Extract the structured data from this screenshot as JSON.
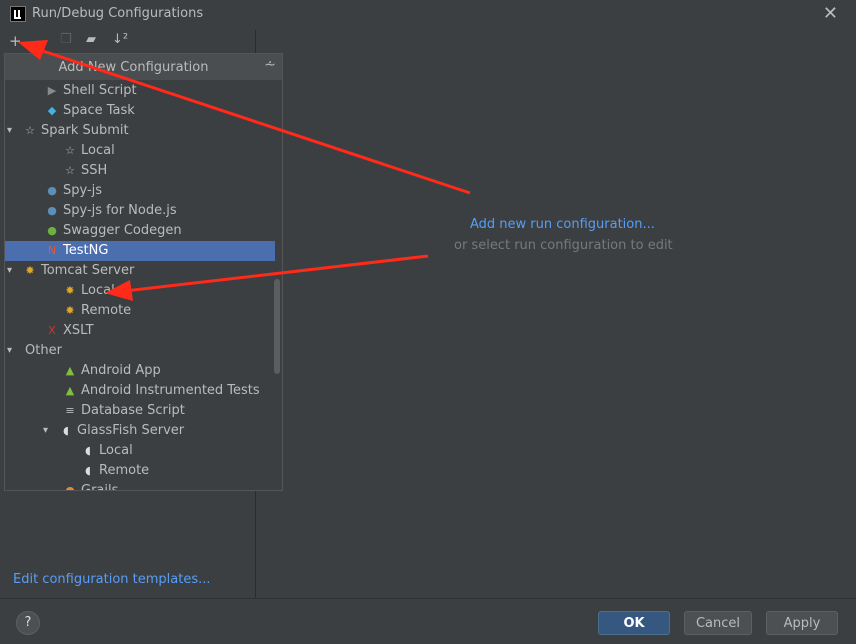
{
  "window": {
    "title": "Run/Debug Configurations"
  },
  "popup": {
    "title": "Add New Configuration"
  },
  "tree": [
    {
      "label": "Shell Script",
      "icon": "shell-script-icon",
      "indent": 1,
      "selected": false
    },
    {
      "label": "Space Task",
      "icon": "space-task-icon",
      "indent": 1,
      "selected": false
    },
    {
      "label": "Spark Submit",
      "icon": "spark-icon",
      "indent": 0,
      "expanded": true,
      "selected": false
    },
    {
      "label": "Local",
      "icon": "spark-icon",
      "indent": 2,
      "selected": false
    },
    {
      "label": "SSH",
      "icon": "spark-icon",
      "indent": 2,
      "selected": false
    },
    {
      "label": "Spy-js",
      "icon": "spy-js-icon",
      "indent": 1,
      "selected": false
    },
    {
      "label": "Spy-js for Node.js",
      "icon": "spy-js-icon",
      "indent": 1,
      "selected": false
    },
    {
      "label": "Swagger Codegen",
      "icon": "swagger-icon",
      "indent": 1,
      "selected": false
    },
    {
      "label": "TestNG",
      "icon": "testng-icon",
      "indent": 1,
      "selected": true
    },
    {
      "label": "Tomcat Server",
      "icon": "tomcat-icon",
      "indent": 0,
      "expanded": true,
      "selected": false
    },
    {
      "label": "Local",
      "icon": "tomcat-icon",
      "indent": 2,
      "selected": false
    },
    {
      "label": "Remote",
      "icon": "tomcat-icon",
      "indent": 2,
      "selected": false
    },
    {
      "label": "XSLT",
      "icon": "xslt-icon",
      "indent": 1,
      "selected": false
    },
    {
      "label": "Other",
      "icon": "",
      "indent": 0,
      "expanded": true,
      "selected": false
    },
    {
      "label": "Android App",
      "icon": "android-icon",
      "indent": 2,
      "selected": false
    },
    {
      "label": "Android Instrumented Tests",
      "icon": "android-icon",
      "indent": 2,
      "selected": false
    },
    {
      "label": "Database Script",
      "icon": "database-icon",
      "indent": 2,
      "selected": false
    },
    {
      "label": "GlassFish Server",
      "icon": "glassfish-icon",
      "indent": 2,
      "expanded": true,
      "selected": false
    },
    {
      "label": "Local",
      "icon": "glassfish-icon",
      "indent": 3,
      "selected": false
    },
    {
      "label": "Remote",
      "icon": "glassfish-icon",
      "indent": 3,
      "selected": false
    },
    {
      "label": "Grails",
      "icon": "grails-icon",
      "indent": 2,
      "selected": false
    }
  ],
  "left": {
    "edit_templates": "Edit configuration templates..."
  },
  "right": {
    "add_link": "Add new run configuration...",
    "hint": "or select run configuration to edit"
  },
  "buttons": {
    "help": "?",
    "ok": "OK",
    "cancel": "Cancel",
    "apply": "Apply"
  },
  "colors": {
    "background": "#3c3f41",
    "selection": "#4b6eaf",
    "link": "#589df6",
    "annotation": "#ff2a1a"
  }
}
